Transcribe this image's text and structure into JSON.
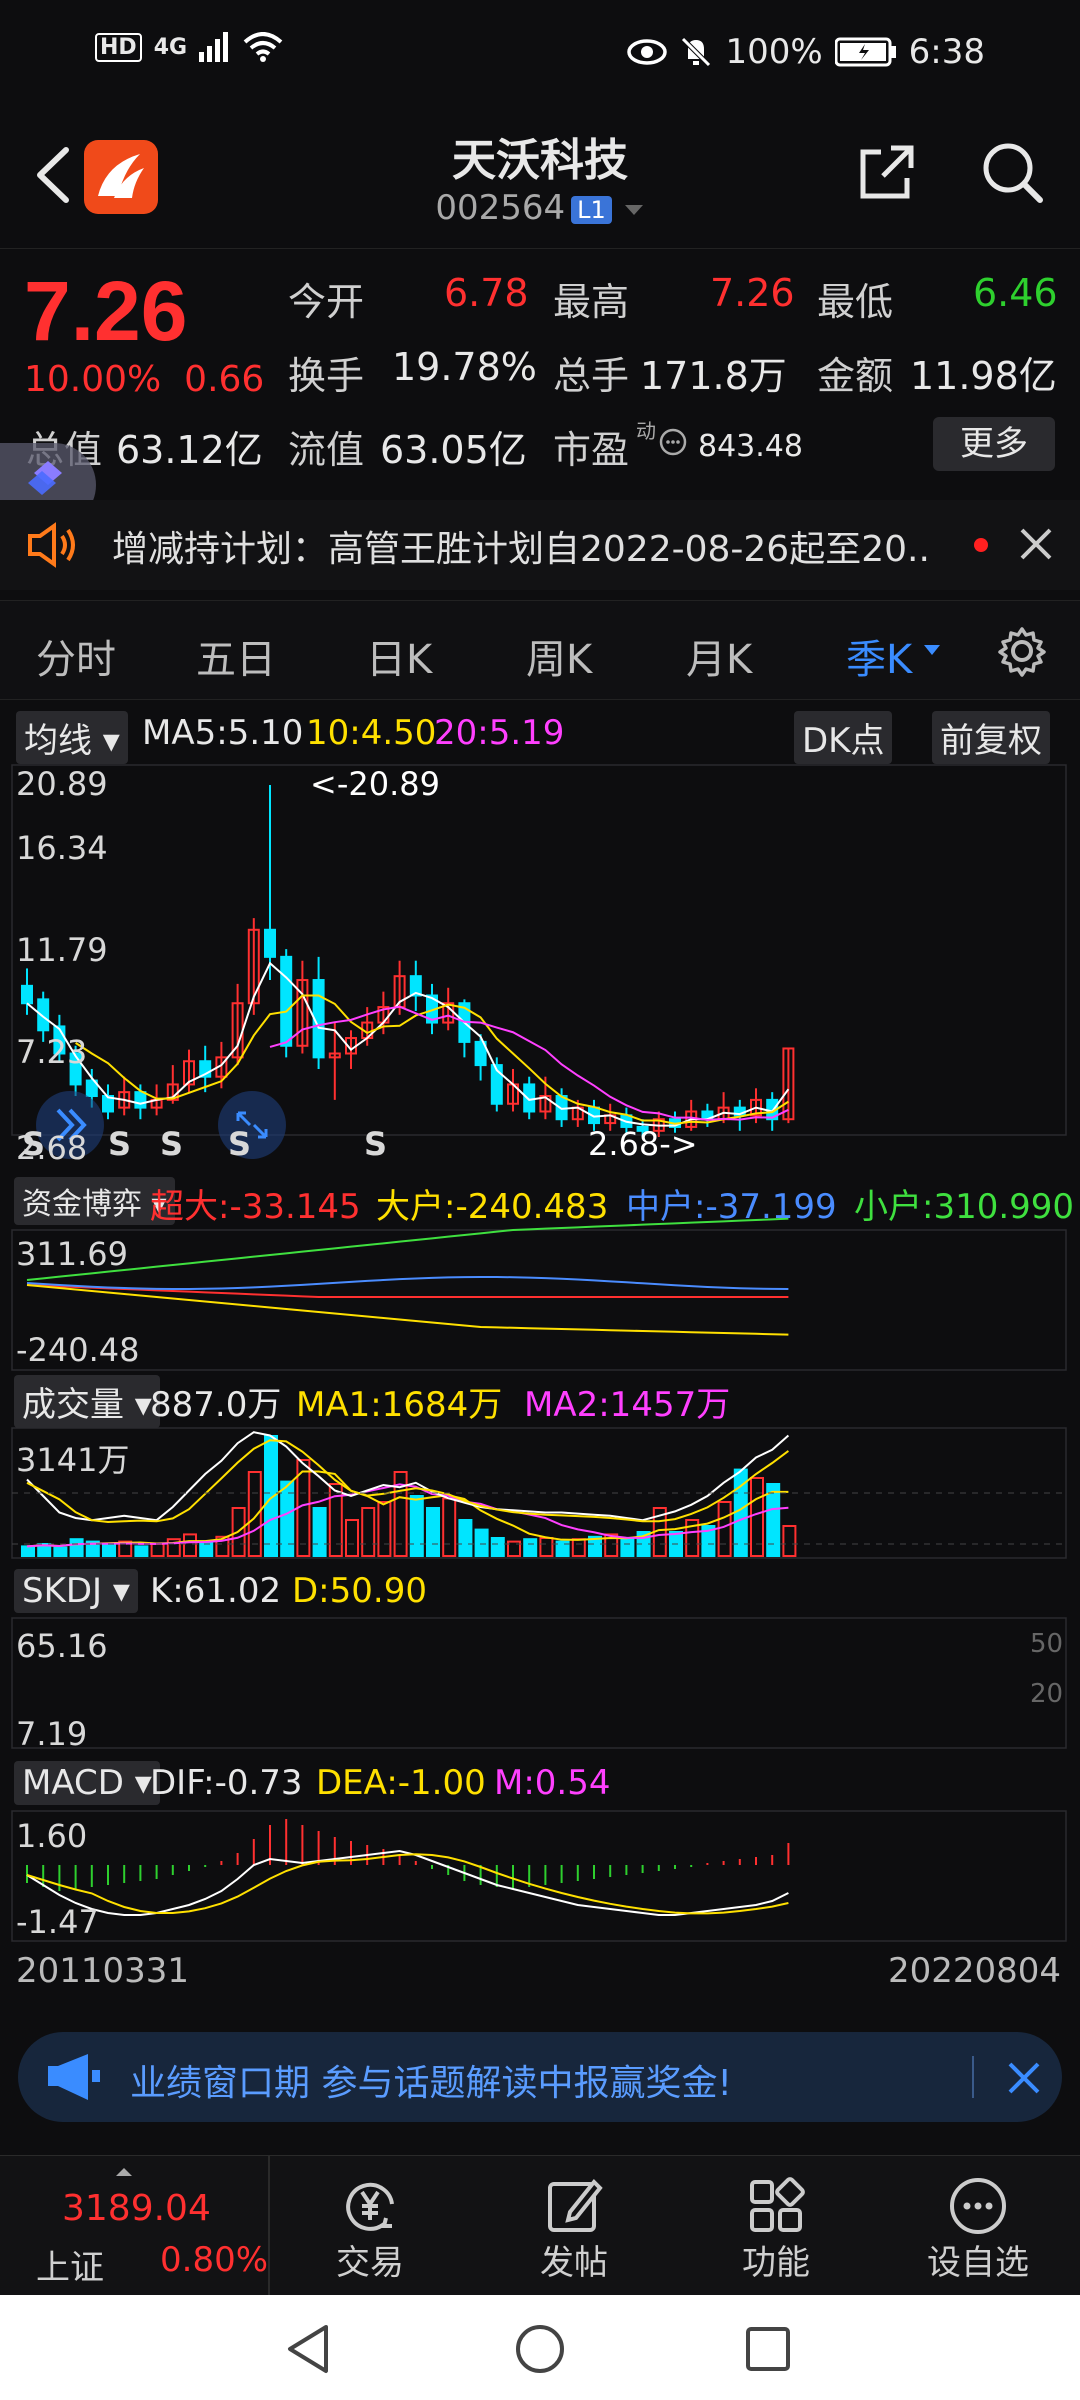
{
  "status_bar": {
    "network": "HD",
    "signal": "4G",
    "battery": "100%",
    "time": "6:38"
  },
  "header": {
    "title": "天沃科技",
    "code": "002564",
    "level": "L1"
  },
  "quote": {
    "price": "7.26",
    "change_pct": "10.00%",
    "change_amt": "0.66",
    "open_label": "今开",
    "open": "6.78",
    "high_label": "最高",
    "high": "7.26",
    "low_label": "最低",
    "low": "6.46",
    "turnover_label": "换手",
    "turnover": "19.78%",
    "volume_label": "总手",
    "volume": "171.8万",
    "amount_label": "金额",
    "amount": "11.98亿",
    "mktcap_label": "总值",
    "mktcap": "63.12亿",
    "float_label": "流值",
    "float": "63.05亿",
    "pe_label": "市盈",
    "pe_sup": "动",
    "pe": "843.48",
    "more_label": "更多"
  },
  "notice": {
    "text": "增减持计划：高管王胜计划自2022-08-26起至20.."
  },
  "tabs": [
    "分时",
    "五日",
    "日K",
    "周K",
    "月K",
    "季K"
  ],
  "active_tab": "季K",
  "kline": {
    "indicator_label": "均线",
    "ma5": "MA5:5.10",
    "ma10": "10:4.50",
    "ma20": "20:5.19",
    "dk_label": "DK点",
    "fq_label": "前复权",
    "y_labels": [
      "20.89",
      "16.34",
      "11.79",
      "7.23",
      "2.68"
    ],
    "high_marker": "<-20.89",
    "low_marker": "2.68->",
    "signal": "S"
  },
  "capital": {
    "label": "资金博弈",
    "super": "超大:-33.145",
    "big": "大户:-240.483",
    "mid": "中户:-37.199",
    "small": "小户:310.990",
    "y_top": "311.69",
    "y_bottom": "-240.48"
  },
  "volume_panel": {
    "label": "成交量",
    "value": "887.0万",
    "ma1": "MA1:1684万",
    "ma2": "MA2:1457万",
    "y_top": "3141万"
  },
  "skdj": {
    "label": "SKDJ",
    "k": "K:61.02",
    "d": "D:50.90",
    "y_top": "65.16",
    "y_bottom": "7.19",
    "ref_hi": "50",
    "ref_lo": "20"
  },
  "macd": {
    "label": "MACD",
    "dif": "DIF:-0.73",
    "dea": "DEA:-1.00",
    "m": "M:0.54",
    "y_top": "1.60",
    "y_bottom": "-1.47"
  },
  "dates": {
    "start": "20110331",
    "end": "20220804"
  },
  "ad": {
    "text": "业绩窗口期 参与话题解读中报赢奖金!"
  },
  "bottom_nav": {
    "index_value": "3189.04",
    "index_name": "上证",
    "index_pct": "0.80%",
    "items": [
      "交易",
      "发帖",
      "功能",
      "设自选"
    ]
  },
  "colors": {
    "up": "#ff3030",
    "down": "#00e5ff",
    "accent": "#3a8cff"
  }
}
